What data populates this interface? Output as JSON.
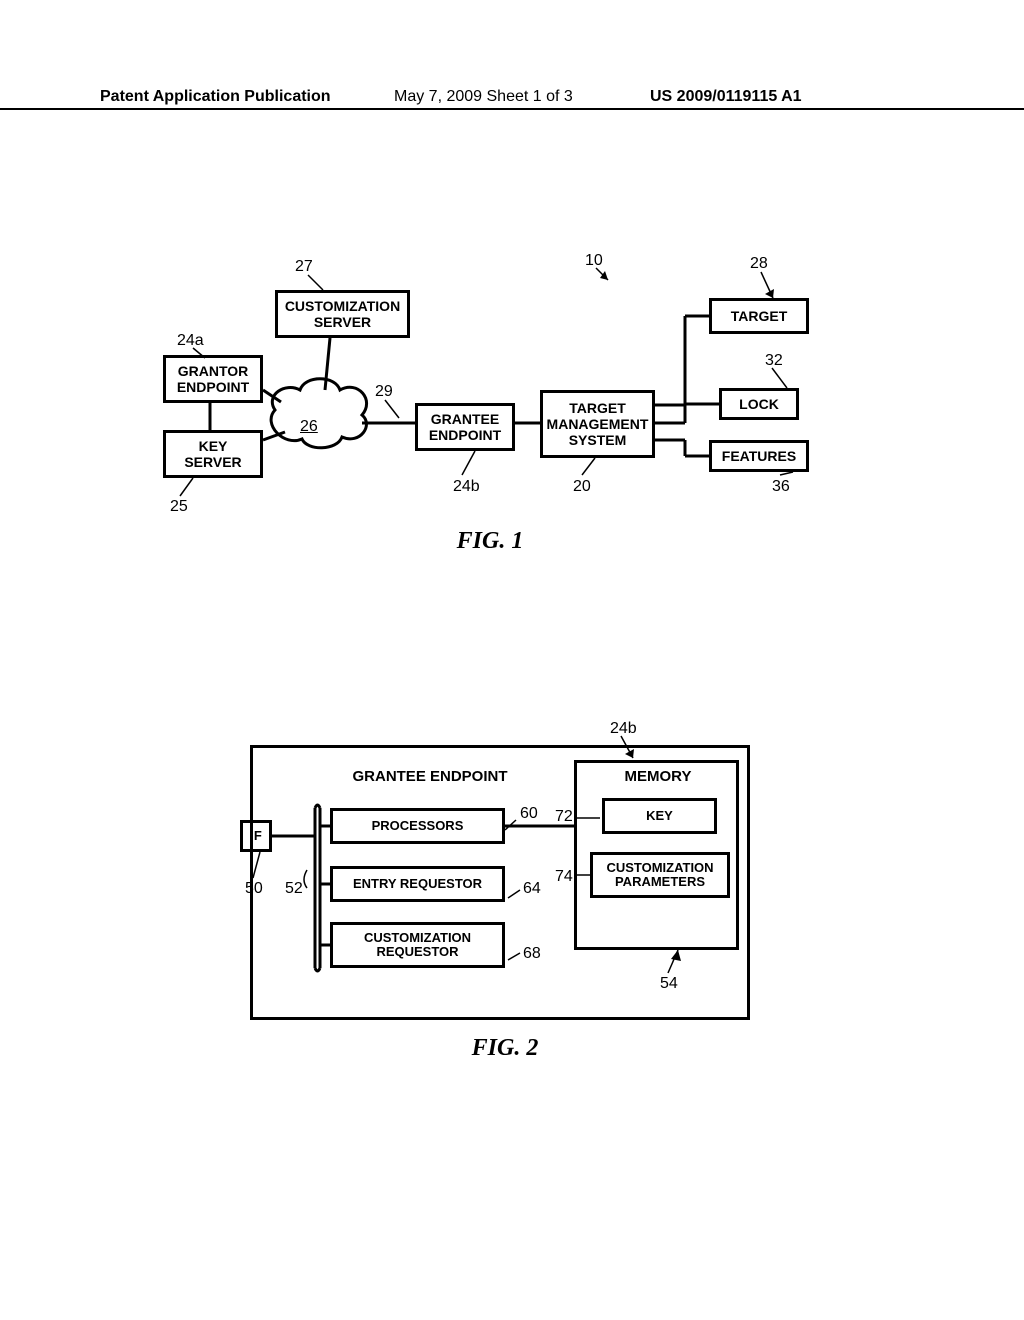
{
  "header": {
    "left": "Patent Application Publication",
    "center": "May 7, 2009  Sheet 1 of 3",
    "right": "US 2009/0119115 A1"
  },
  "fig1": {
    "caption": "FIG. 1",
    "refs": {
      "r10": "10",
      "r20": "20",
      "r24a": "24a",
      "r24b": "24b",
      "r25": "25",
      "r26": "26",
      "r27": "27",
      "r28": "28",
      "r29": "29",
      "r32": "32",
      "r36": "36"
    },
    "boxes": {
      "custServer": "CUSTOMIZATION\nSERVER",
      "grantor": "GRANTOR\nENDPOINT",
      "keyServer": "KEY\nSERVER",
      "grantee": "GRANTEE\nENDPOINT",
      "tms": "TARGET\nMANAGEMENT\nSYSTEM",
      "target": "TARGET",
      "lock": "LOCK",
      "features": "FEATURES"
    }
  },
  "fig2": {
    "caption": "FIG. 2",
    "refs": {
      "r24b": "24b",
      "r50": "50",
      "r52": "52",
      "r54": "54",
      "r60": "60",
      "r64": "64",
      "r68": "68",
      "r72": "72",
      "r74": "74"
    },
    "titles": {
      "grantee": "GRANTEE ENDPOINT",
      "memory": "MEMORY"
    },
    "boxes": {
      "if": "IF",
      "processors": "PROCESSORS",
      "entry": "ENTRY REQUESTOR",
      "custreq": "CUSTOMIZATION\nREQUESTOR",
      "key": "KEY",
      "params": "CUSTOMIZATION\nPARAMETERS"
    }
  }
}
